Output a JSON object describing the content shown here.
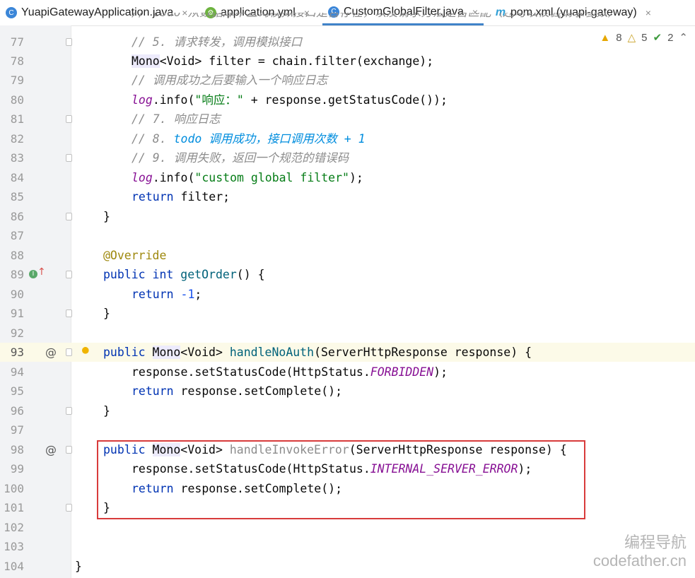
{
  "tabs": [
    {
      "label": "YuapiGatewayApplication.java",
      "icon": "java-class-icon",
      "close": "×"
    },
    {
      "label": "application.yml",
      "icon": "spring-yml-icon",
      "close": "×"
    },
    {
      "label": "CustomGlobalFilter.java",
      "icon": "java-class-icon",
      "close": "×",
      "active": true
    },
    {
      "label": "pom.xml (yuapi-gateway)",
      "icon": "maven-icon",
      "close": "×"
    }
  ],
  "inspections": {
    "warnings": "8",
    "weak_warnings": "5",
    "ok": "2"
  },
  "line_numbers": [
    "77",
    "78",
    "79",
    "80",
    "81",
    "82",
    "83",
    "84",
    "85",
    "86",
    "87",
    "88",
    "89",
    "90",
    "91",
    "92",
    "93",
    "94",
    "95",
    "96",
    "97",
    "98",
    "99",
    "100",
    "101",
    "102",
    "103",
    "104"
  ],
  "code": {
    "l76": "// todo 从数据库中查询模拟接口是否存在，以及请求方法是否匹配（还可以校验请求参数）",
    "l77": "// 5. 请求转发，调用模拟接口",
    "l78": [
      "Mono",
      "<Void> filter = chain.filter(exchange);"
    ],
    "l79": "// 调用成功之后要输入一个响应日志",
    "l80": [
      "log",
      ".info(",
      "\"响应：\"",
      " + response.getStatusCode());"
    ],
    "l81": "// 7. 响应日志",
    "l82": [
      "// 8. ",
      "todo 调用成功，接口调用次数 + 1"
    ],
    "l83": "// 9. 调用失败，返回一个规范的错误码",
    "l84": [
      "log",
      ".info(",
      "\"custom global filter\"",
      ");"
    ],
    "l85": [
      "return",
      " filter;"
    ],
    "l86": "}",
    "l88": "@Override",
    "l89": [
      "public",
      " ",
      "int",
      " ",
      "getOrder",
      "() {"
    ],
    "l90": [
      "return",
      " ",
      "-1",
      ";"
    ],
    "l91": "}",
    "l93": [
      "public",
      " ",
      "Mono",
      "<Void> ",
      "handleNoAuth",
      "(ServerHttpResponse response) {"
    ],
    "l94": [
      "response.setStatusCode(HttpStatus.",
      "FORBIDDEN",
      ");"
    ],
    "l95": [
      "return",
      " response.setComplete();"
    ],
    "l96": "}",
    "l98": [
      "public",
      " ",
      "Mono",
      "<Void> ",
      "handleInvokeError",
      "(ServerHttpResponse response) {"
    ],
    "l99": [
      "response.setStatusCode(HttpStatus.",
      "INTERNAL_SERVER_ERROR",
      ");"
    ],
    "l100": [
      "return",
      " response.setComplete();"
    ],
    "l101": "}",
    "l104": "}"
  },
  "gutter_marks": {
    "at_symbol": "@",
    "implements_marker": "I↑",
    "bulb": "💡"
  },
  "watermark": {
    "line1": "编程导航",
    "line2": "codefather.cn"
  },
  "colors": {
    "keyword": "#0033b3",
    "comment": "#8c8c8c",
    "string": "#067d17",
    "annotation": "#9e880d",
    "function": "#00627a",
    "static_field": "#871094",
    "todo": "#008dde",
    "highlight_box": "#d83b3b",
    "active_tab": "#4083c9"
  }
}
